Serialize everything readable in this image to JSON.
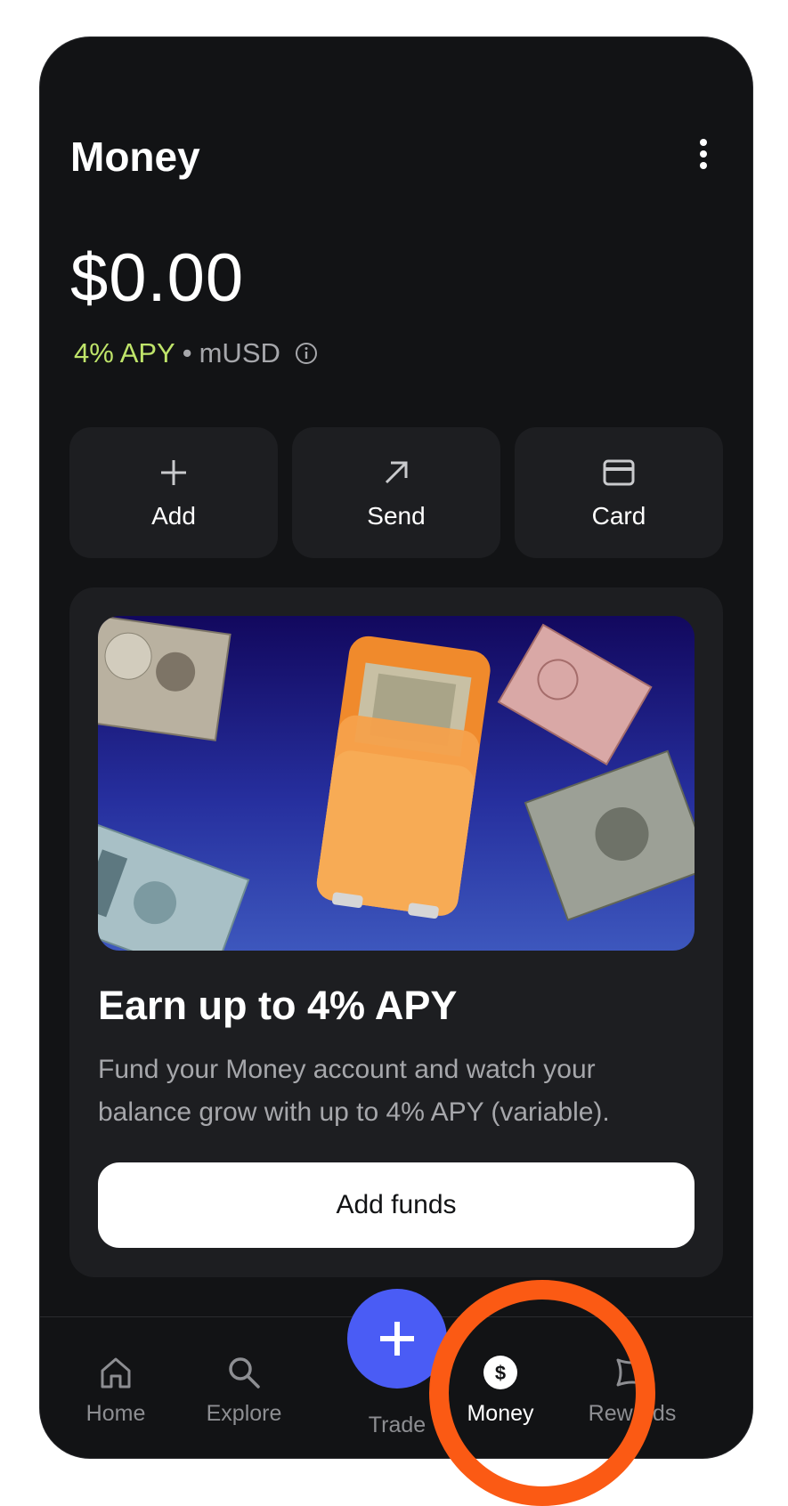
{
  "header": {
    "title": "Money"
  },
  "balance": {
    "amount": "$0.00",
    "apy": "4% APY",
    "separator": "•",
    "currency": "mUSD"
  },
  "actions": [
    {
      "label": "Add",
      "icon": "plus-icon"
    },
    {
      "label": "Send",
      "icon": "arrow-up-right-icon"
    },
    {
      "label": "Card",
      "icon": "card-icon"
    }
  ],
  "promo": {
    "title": "Earn up to 4% APY",
    "text": "Fund your Money account and watch your balance grow with up to 4% APY (variable).",
    "button": "Add funds"
  },
  "nav": {
    "items": [
      {
        "label": "Home",
        "icon": "home-icon"
      },
      {
        "label": "Explore",
        "icon": "search-icon"
      },
      {
        "label": "Trade",
        "icon": "plus-icon"
      },
      {
        "label": "Money",
        "icon": "dollar-circle-icon",
        "active": true
      },
      {
        "label": "Rewards",
        "icon": "rewards-icon"
      }
    ]
  },
  "colors": {
    "background": "#121315",
    "card": "#1d1e21",
    "apy_green": "#bfe46a",
    "trade_blue": "#4a5cf5",
    "highlight_orange": "#fb5a14"
  }
}
